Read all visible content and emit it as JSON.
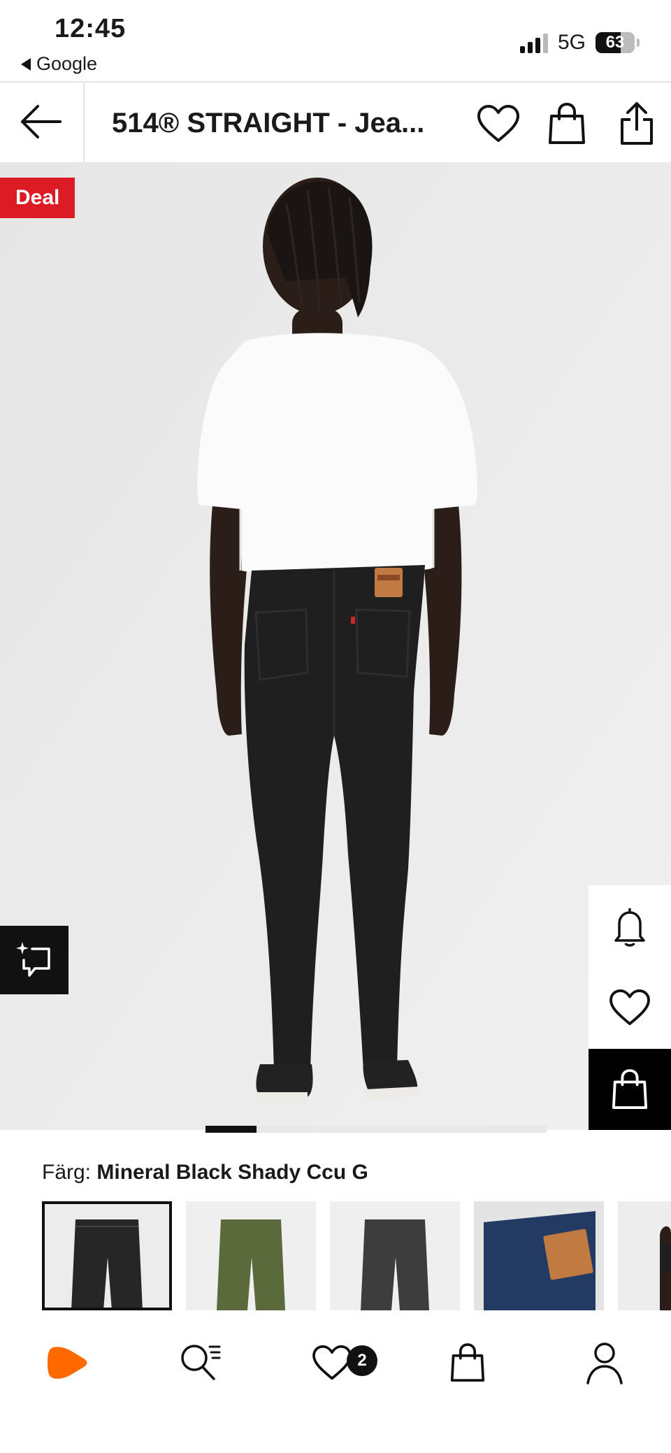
{
  "status_bar": {
    "time": "12:45",
    "back_app": "Google",
    "network": "5G",
    "battery": "63",
    "battery_level": 0.63
  },
  "header": {
    "title": "514® STRAIGHT - Jea..."
  },
  "product_image": {
    "deal_badge": "Deal",
    "carousel_progress": 0.15
  },
  "color": {
    "label": "Färg:",
    "value": "Mineral Black Shady Ccu G"
  },
  "swatches": [
    {
      "name": "black",
      "color": "#2a2a2a",
      "selected": true
    },
    {
      "name": "olive",
      "color": "#5b6a3a",
      "selected": false
    },
    {
      "name": "grey",
      "color": "#3d3d3d",
      "selected": false
    },
    {
      "name": "blue-back",
      "color": "#233a63",
      "selected": false
    }
  ],
  "tabbar": {
    "wishlist_count": "2"
  },
  "colors": {
    "deal": "#dc1b24",
    "brand": "#ff6900"
  }
}
